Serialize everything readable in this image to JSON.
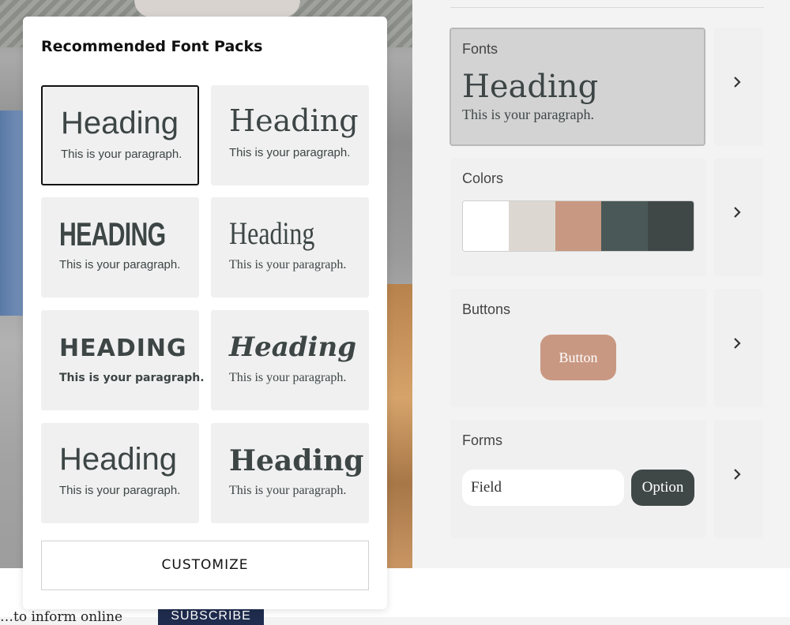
{
  "modal": {
    "title": "Recommended Font Packs",
    "font_packs": [
      {
        "heading": "Heading",
        "paragraph": "This is your paragraph.",
        "selected": true
      },
      {
        "heading": "Heading",
        "paragraph": "This is your paragraph.",
        "selected": false
      },
      {
        "heading": "HEADING",
        "paragraph": "This is your paragraph.",
        "selected": false
      },
      {
        "heading": "Heading",
        "paragraph": "This is your paragraph.",
        "selected": false
      },
      {
        "heading": "HEADING",
        "paragraph": "This is your paragraph.",
        "selected": false
      },
      {
        "heading": "Heading",
        "paragraph": "This is your paragraph.",
        "selected": false
      },
      {
        "heading": "Heading",
        "paragraph": "This is your paragraph.",
        "selected": false
      },
      {
        "heading": "Heading",
        "paragraph": "This is your paragraph.",
        "selected": false
      }
    ],
    "customize_label": "CUSTOMIZE"
  },
  "panels": {
    "fonts": {
      "label": "Fonts",
      "heading": "Heading",
      "paragraph": "This is your paragraph."
    },
    "colors": {
      "label": "Colors",
      "swatches": [
        "#ffffff",
        "#dcd8d1",
        "#c99882",
        "#4a5957",
        "#404847"
      ]
    },
    "buttons": {
      "label": "Buttons",
      "button_label": "Button",
      "button_color": "#c99882"
    },
    "forms": {
      "label": "Forms",
      "field_label": "Field",
      "option_label": "Option",
      "option_color": "#404847"
    },
    "arrow_icon": "chevron-right-icon"
  },
  "footer": {
    "text": "…to inform online",
    "subscribe_label": "SUBSCRIBE"
  }
}
